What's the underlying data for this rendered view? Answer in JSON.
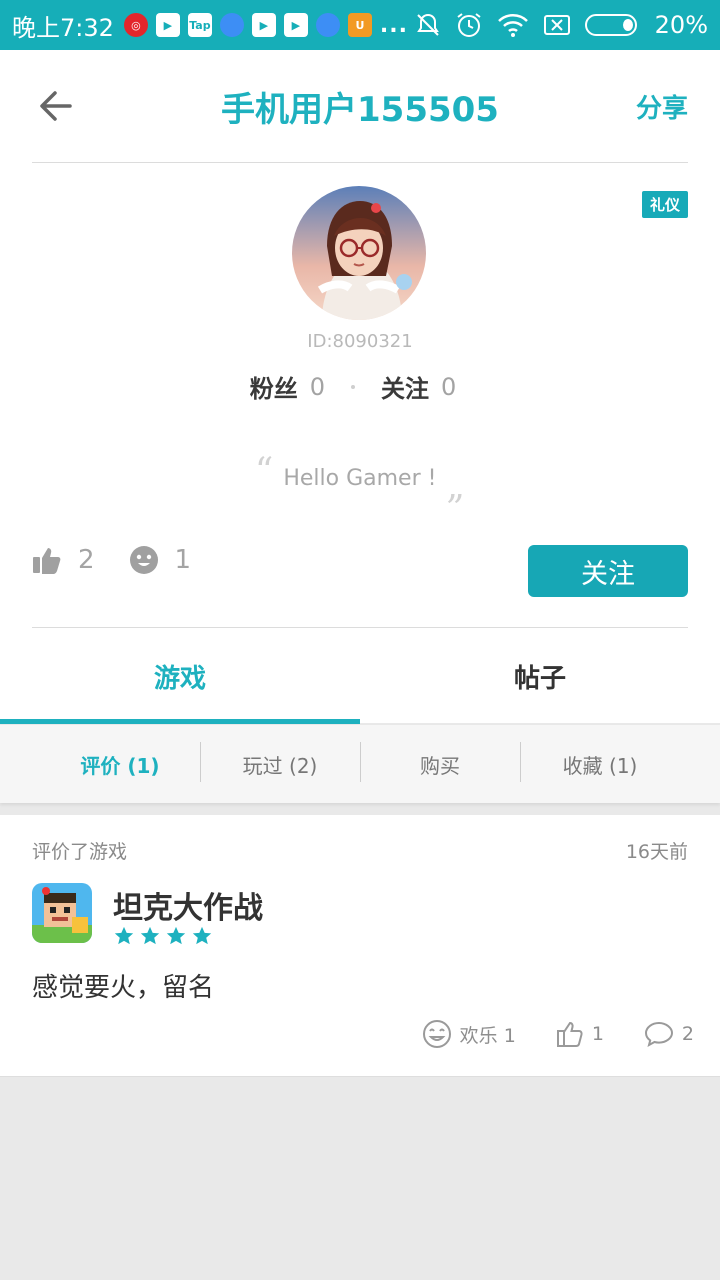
{
  "statusbar": {
    "time": "晚上7:32",
    "app_icons": [
      {
        "name": "netease-music-icon",
        "style": "red",
        "glyph": "◎"
      },
      {
        "name": "play-store-icon",
        "style": "",
        "glyph": "▶"
      },
      {
        "name": "taptap-icon",
        "style": "",
        "glyph": "Tap"
      },
      {
        "name": "bubble-app-icon",
        "style": "blue",
        "glyph": ""
      },
      {
        "name": "play-store-icon",
        "style": "",
        "glyph": "▶"
      },
      {
        "name": "play-store-icon",
        "style": "",
        "glyph": "▶"
      },
      {
        "name": "bubble-app-icon",
        "style": "blue",
        "glyph": ""
      },
      {
        "name": "uc-browser-icon",
        "style": "orange",
        "glyph": "U"
      }
    ],
    "more": "...",
    "battery": "20%"
  },
  "header": {
    "title": "手机用户155505",
    "share": "分享"
  },
  "profile": {
    "badge": "礼仪",
    "user_id": "ID:8090321",
    "fans_label": "粉丝",
    "fans_count": "0",
    "follow_label": "关注",
    "follow_count": "0",
    "signature": "Hello Gamer !",
    "likes": "2",
    "smiles": "1",
    "follow_button": "关注"
  },
  "tabs": {
    "games": "游戏",
    "posts": "帖子"
  },
  "subtabs": {
    "review": "评价 (1)",
    "played": "玩过 (2)",
    "bought": "购买",
    "favorites": "收藏 (1)"
  },
  "review": {
    "type": "评价了游戏",
    "time": "16天前",
    "game_name": "坦克大作战",
    "rating": 4,
    "text": "感觉要火，留名",
    "fun_label": "欢乐 1",
    "likes": "1",
    "comments": "2"
  },
  "colors": {
    "accent": "#1eb1bf",
    "statusbar": "#16aeb8"
  }
}
